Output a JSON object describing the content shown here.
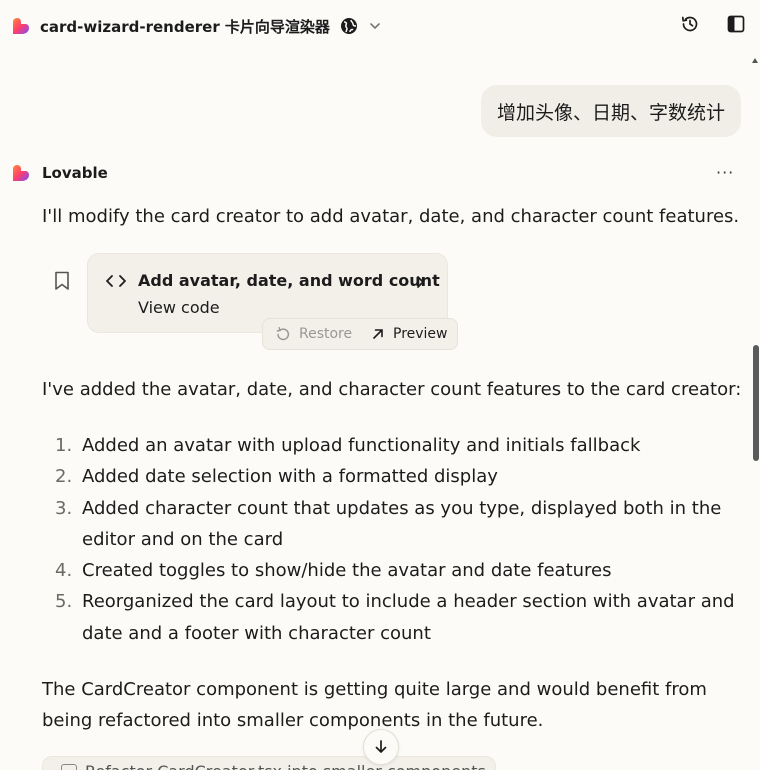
{
  "header": {
    "project_title": "card-wizard-renderer 卡片向导渲染器"
  },
  "user_message": "增加头像、日期、字数统计",
  "assistant": {
    "name": "Lovable",
    "more_label": "···",
    "intro": "I'll modify the card creator to add avatar, date, and character count features.",
    "code_card": {
      "title": "Add avatar, date, and word count",
      "subtitle": "View code",
      "restore_label": "Restore",
      "preview_label": "Preview"
    },
    "summary": "I've added the avatar, date, and character count features to the card creator:",
    "list": [
      {
        "num": "1.",
        "text": "Added an avatar with upload functionality and initials fallback"
      },
      {
        "num": "2.",
        "text": "Added date selection with a formatted display"
      },
      {
        "num": "3.",
        "text": "Added character count that updates as you type, displayed both in the editor and on the card"
      },
      {
        "num": "4.",
        "text": "Created toggles to show/hide the avatar and date features"
      },
      {
        "num": "5.",
        "text": "Reorganized the card layout to include a header section with avatar and date and a footer with character count"
      }
    ],
    "closing": "The CardCreator component is getting quite large and would benefit from being refactored into smaller components in the future.",
    "next_suggestion": "Refactor CardCreator.tsx into smaller components"
  },
  "colors": {
    "background": "#fcfbf8",
    "bubble": "#f1eee7",
    "card": "#f3f0ea",
    "text": "#1c1c1c",
    "muted": "#9a9893"
  }
}
